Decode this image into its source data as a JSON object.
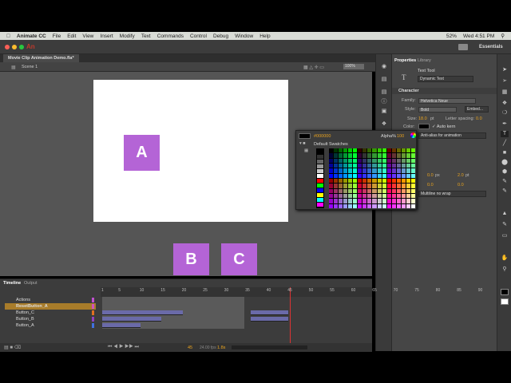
{
  "menubar": {
    "app": "Animate CC",
    "items": [
      "File",
      "Edit",
      "View",
      "Insert",
      "Modify",
      "Text",
      "Commands",
      "Control",
      "Debug",
      "Window",
      "Help"
    ],
    "battery": "52%",
    "clock": "Wed 4:51 PM"
  },
  "titlebar": {
    "logo": "An",
    "workspace": "Essentials"
  },
  "document": {
    "tab": "Movie Clip Animation Demo.fla*",
    "scene": "Scene 1",
    "zoom": "100%"
  },
  "stage": {
    "clips": [
      "A",
      "B",
      "C"
    ]
  },
  "properties": {
    "tabs": [
      "Properties",
      "Library"
    ],
    "tool": "Text Tool",
    "text_type": "Dynamic Text",
    "section": "Character",
    "family_label": "Family:",
    "family": "Helvetica Neue",
    "style_label": "Style:",
    "style": "Bold",
    "embed": "Embed...",
    "size_label": "Size:",
    "size": "18.0",
    "size_unit": "pt",
    "spacing_label": "Letter spacing:",
    "spacing": "0.0",
    "color_label": "Color:",
    "autokern": "Auto kern",
    "antialias": "Anti-alias for animation",
    "indent1": "0.0",
    "indent2": "0.0",
    "px": "px",
    "linesp": "2.0",
    "linesp_unit": "pt",
    "margin": "0.0",
    "multiline": "Multiline no wrap"
  },
  "swatch": {
    "hex": "#000000",
    "alpha_label": "Alpha%",
    "alpha": "100",
    "title": "Default Swatches"
  },
  "timeline": {
    "tabs": [
      "Timeline",
      "Output"
    ],
    "ticks": [
      "1",
      "5",
      "10",
      "15",
      "20",
      "25",
      "30",
      "35",
      "40",
      "45",
      "50",
      "55",
      "60",
      "65",
      "70",
      "75",
      "80",
      "85",
      "90"
    ],
    "layers": [
      {
        "name": "Actions",
        "color": "#c050d0",
        "selected": false,
        "tweens": []
      },
      {
        "name": "ResetButton_A",
        "color": "#d050c0",
        "selected": true,
        "tweens": []
      },
      {
        "name": "Button_C",
        "color": "#e07020",
        "selected": false,
        "tweens": [
          [
            1,
            19
          ],
          [
            36,
            44
          ]
        ]
      },
      {
        "name": "Button_B",
        "color": "#9040c0",
        "selected": false,
        "tweens": [
          [
            1,
            14
          ],
          [
            36,
            44
          ]
        ]
      },
      {
        "name": "Button_A",
        "color": "#4070e0",
        "selected": false,
        "tweens": [
          [
            1,
            9
          ]
        ]
      }
    ],
    "current_frame": "45",
    "fps": "24.00 fps",
    "time": "1.8s",
    "playhead_frame": 45
  },
  "colors": {
    "clip": "#b464d6",
    "accent": "#e8a21e"
  }
}
